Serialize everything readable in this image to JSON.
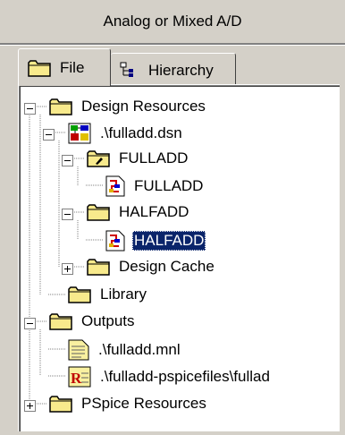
{
  "panel": {
    "title": "Analog or Mixed A/D"
  },
  "tabs": [
    {
      "label": "File",
      "icon": "folder-icon",
      "active": true
    },
    {
      "label": "Hierarchy",
      "icon": "hierarchy-icon",
      "active": false
    }
  ],
  "tree": [
    {
      "label": "Design Resources",
      "icon": "folder",
      "expander": "-"
    },
    {
      "label": ".\\fulladd.dsn",
      "icon": "design-file",
      "expander": "-"
    },
    {
      "label": "FULLADD",
      "icon": "folder-open",
      "expander": "-"
    },
    {
      "label": "FULLADD",
      "icon": "schematic-page",
      "expander": ""
    },
    {
      "label": "HALFADD",
      "icon": "folder",
      "expander": "-"
    },
    {
      "label": "HALFADD",
      "icon": "schematic-page",
      "expander": "",
      "selected": true
    },
    {
      "label": "Design Cache",
      "icon": "folder",
      "expander": "+"
    },
    {
      "label": "Library",
      "icon": "folder",
      "expander": ""
    },
    {
      "label": "Outputs",
      "icon": "folder",
      "expander": "-"
    },
    {
      "label": ".\\fulladd.mnl",
      "icon": "netlist-file",
      "expander": ""
    },
    {
      "label": ".\\fulladd-pspicefiles\\fullad",
      "icon": "report-file",
      "expander": ""
    },
    {
      "label": "PSpice Resources",
      "icon": "folder",
      "expander": "+"
    }
  ],
  "colors": {
    "folder": "#f8ea8c",
    "selection": "#0a246a",
    "face": "#d4d0c8"
  }
}
